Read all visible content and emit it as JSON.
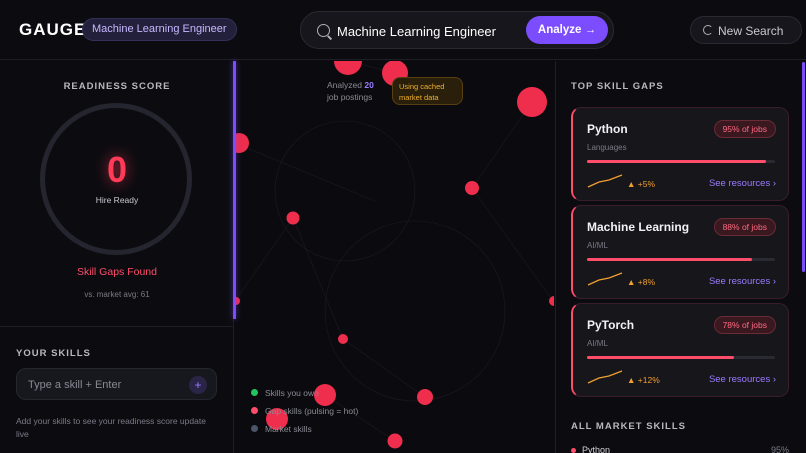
{
  "header": {
    "logo": "GAUGE",
    "role_badge": "Machine Learning Engineer",
    "search": {
      "value": "Machine Learning Engineer",
      "icon": "search-icon"
    },
    "analyze_label": "Analyze →",
    "new_search_label": "New Search"
  },
  "readiness": {
    "title": "READINESS SCORE",
    "score": "0",
    "score_label": "Hire Ready",
    "gaps_label": "Skill Gaps Found",
    "market_avg": "vs. market avg: 61"
  },
  "your_skills": {
    "title": "YOUR SKILLS",
    "placeholder": "Type a skill + Enter",
    "add_label": "+",
    "hint": "Add your skills to see your readiness score update live"
  },
  "analysis": {
    "analyzed_prefix": "Analyzed",
    "job_count": "20",
    "analyzed_suffix": "job postings",
    "cache_badge": "Using cached market data"
  },
  "legend": [
    {
      "label": "Skills you own",
      "color": "#22c55e"
    },
    {
      "label": "Gap skills (pulsing = hot)",
      "color": "#ff4d6a"
    },
    {
      "label": "Market skills",
      "color": "#4a5568"
    }
  ],
  "top_skill_gaps": {
    "title": "TOP SKILL GAPS",
    "resources_label": "See resources ›",
    "cards": [
      {
        "name": "Python",
        "badge": "95% of jobs",
        "percent": 95,
        "category": "Languages",
        "trend": "▲ +5%"
      },
      {
        "name": "Machine Learning",
        "badge": "88% of jobs",
        "percent": 88,
        "category": "AI/ML",
        "trend": "▲ +8%"
      },
      {
        "name": "PyTorch",
        "badge": "78% of jobs",
        "percent": 78,
        "category": "AI/ML",
        "trend": "▲ +12%"
      }
    ]
  },
  "all_market_skills": {
    "title": "ALL MARKET SKILLS",
    "items": [
      {
        "name": "Python",
        "pct": "95%"
      }
    ]
  },
  "colors": {
    "accent": "#7c4dff",
    "gap": "#ff4d6a",
    "background": "#0c0c10"
  }
}
